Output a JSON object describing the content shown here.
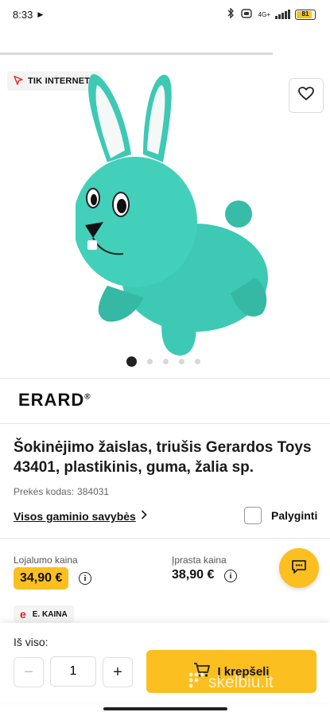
{
  "status_bar": {
    "time": "8:33",
    "network": "4G+",
    "battery": "81"
  },
  "gallery": {
    "badge": "TIK INTERNETU",
    "image_icon": "bouncy-rabbit-toy",
    "slide_count": 5,
    "active_slide": 1
  },
  "brand": {
    "name": "ERARD",
    "mark": "®"
  },
  "product": {
    "title": "Šokinėjimo žaislas, triušis Gerardos Toys 43401, plastikinis, guma, žalia sp.",
    "sku_label": "Prekės kodas:",
    "sku_value": "384031",
    "all_properties": "Visos gaminio savybės",
    "compare": "Palyginti"
  },
  "prices": {
    "loyalty_label": "Lojalumo kaina",
    "loyalty_value": "34,90 €",
    "regular_label": "Įprasta kaina",
    "regular_value": "38,90 €",
    "e_price_letter": "e",
    "e_price_label": "E. KAINA"
  },
  "cart": {
    "total_label": "Iš viso:",
    "minus": "−",
    "plus": "+",
    "quantity": "1",
    "add_to_cart": "Į krepšelį"
  },
  "watermark": "skelbiu.lt",
  "colors": {
    "accent": "#fbbf1f",
    "rabbit": "#3dc9b4",
    "e_price": "#e2231a"
  }
}
